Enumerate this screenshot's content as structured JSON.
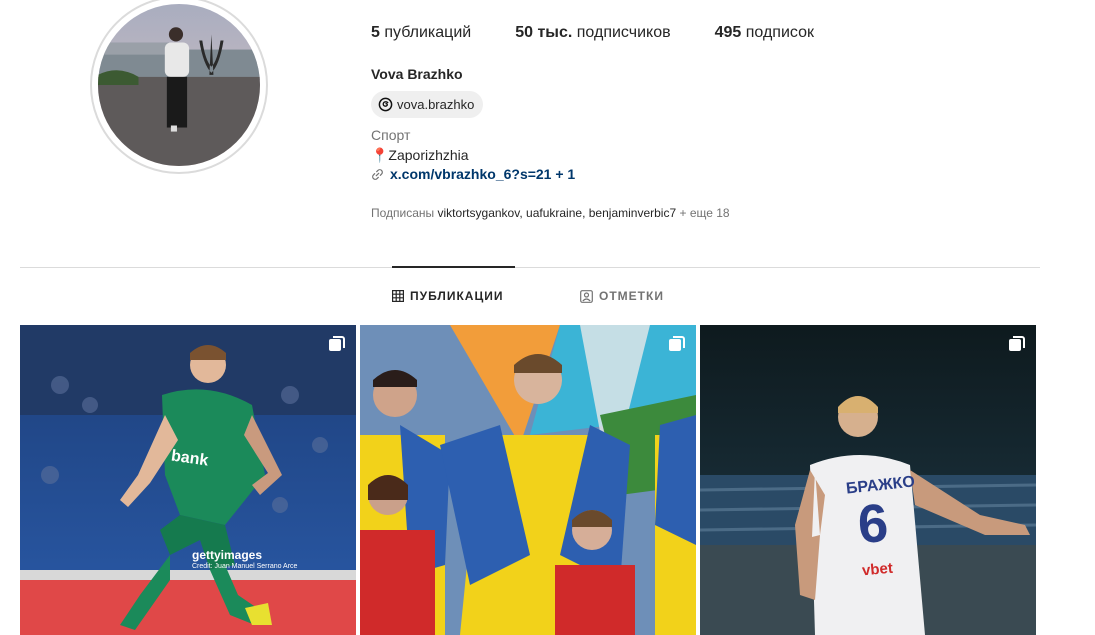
{
  "profile": {
    "username": "Vova Brazhko",
    "threads_handle": "vova.brazhko",
    "category": "Спорт",
    "location": "📍Zaporizhzhia",
    "link": "x.com/vbrazhko_6?s=21 + 1"
  },
  "stats": {
    "posts_count": "5",
    "posts_label": "публикаций",
    "followers_count": "50 тыс.",
    "followers_label": "подписчиков",
    "following_count": "495",
    "following_label": "подписок"
  },
  "followed_by": {
    "prefix": "Подписаны",
    "names": [
      "viktortsygankov",
      "uafukraine",
      "benjaminverbic7"
    ],
    "sep": ",",
    "more": "+ еще 18"
  },
  "tabs": [
    {
      "label": "ПУБЛИКАЦИИ",
      "icon": "grid-icon",
      "active": true
    },
    {
      "label": "ОТМЕТКИ",
      "icon": "tagged-icon",
      "active": false
    }
  ],
  "posts": [
    {
      "icon": "carousel-icon",
      "watermark": "gettyimages",
      "credit": "Credit: Juan Manuel Serrano Arce",
      "jersey": "bank"
    },
    {
      "icon": "carousel-icon"
    },
    {
      "icon": "carousel-icon",
      "jersey_name": "БРАЖКО",
      "jersey_number": "6",
      "sponsor": "vbet"
    }
  ],
  "colors": {
    "link": "#00376b",
    "muted": "#737373",
    "chip_bg": "#efefef",
    "divider": "#dbdbdb"
  }
}
